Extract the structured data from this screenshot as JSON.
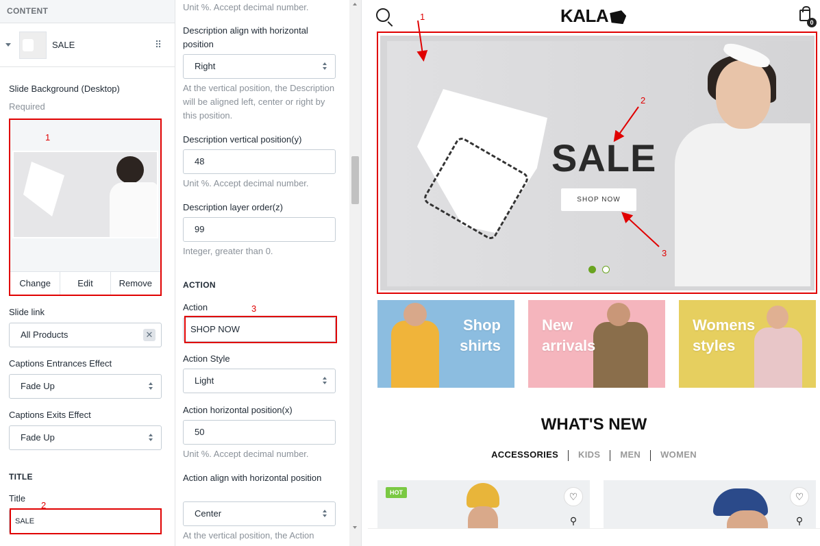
{
  "left": {
    "section_title": "CONTENT",
    "block_label": "SALE",
    "slide_bg_label": "Slide Background (Desktop)",
    "required": "Required",
    "img_actions": {
      "change": "Change",
      "edit": "Edit",
      "remove": "Remove"
    },
    "slide_link_label": "Slide link",
    "slide_link_value": "All Products",
    "entrance_label": "Captions Entrances Effect",
    "entrance_value": "Fade Up",
    "exit_label": "Captions Exits Effect",
    "exit_value": "Fade Up",
    "title_section": "TITLE",
    "title_label": "Title",
    "title_value": "SALE"
  },
  "mid": {
    "unit_help_top": "Unit %. Accept decimal number.",
    "desc_align_label": "Description align with horizontal position",
    "desc_align_value": "Right",
    "desc_align_help": "At the vertical position, the Description will be aligned left, center or right by this position.",
    "desc_vpos_label": "Description vertical position(y)",
    "desc_vpos_value": "48",
    "desc_vpos_help": "Unit %. Accept decimal number.",
    "desc_layer_label": "Description layer order(z)",
    "desc_layer_value": "99",
    "desc_layer_help": "Integer, greater than 0.",
    "action_section": "ACTION",
    "action_label": "Action",
    "action_value": "SHOP NOW",
    "action_style_label": "Action Style",
    "action_style_value": "Light",
    "action_hpos_label": "Action horizontal position(x)",
    "action_hpos_value": "50",
    "action_hpos_help": "Unit %. Accept decimal number.",
    "action_align_label": "Action align with horizontal position",
    "action_align_value": "Center",
    "action_align_help": "At the vertical position, the Action"
  },
  "annotations": {
    "n1": "1",
    "n2": "2",
    "n3": "3"
  },
  "store": {
    "logo": "KALA",
    "cart_count": "0",
    "hero_title": "SALE",
    "hero_button": "SHOP NOW",
    "categories": [
      {
        "line1": "Shop",
        "line2": "shirts",
        "bg": "#8cbde0"
      },
      {
        "line1": "New",
        "line2": "arrivals",
        "bg": "#f5b5bd"
      },
      {
        "line1": "Womens",
        "line2": "styles",
        "bg": "#e6cf5f"
      }
    ],
    "section_title": "WHAT'S NEW",
    "tabs": [
      "ACCESSORIES",
      "KIDS",
      "MEN",
      "WOMEN"
    ],
    "hot_badge": "HOT",
    "colors": {
      "accent": "#6aa421",
      "annotation": "#e00000",
      "hot": "#7ac943"
    }
  }
}
